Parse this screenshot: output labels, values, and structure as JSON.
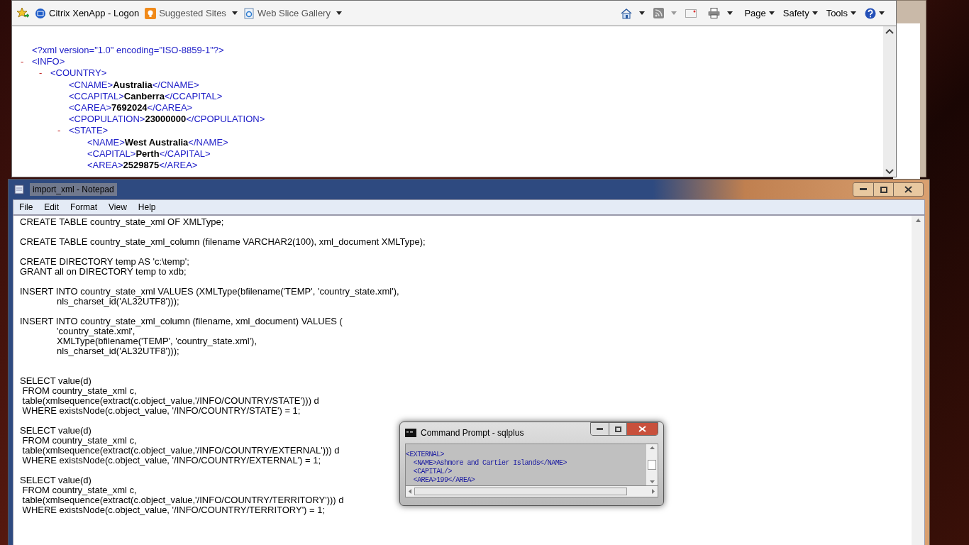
{
  "browser": {
    "favorites_bar": [
      {
        "label": "Citrix XenApp - Logon",
        "dropdown": false
      },
      {
        "label": "Suggested Sites",
        "dropdown": true
      },
      {
        "label": "Web Slice Gallery",
        "dropdown": true
      }
    ],
    "command_bar": [
      "Page",
      "Safety",
      "Tools"
    ],
    "xml": [
      {
        "kind": "pi",
        "text": "<?xml version=\"1.0\" encoding=\"ISO-8859-1\"?>"
      },
      {
        "kind": "parent",
        "toggle": "-",
        "tag": "<INFO>",
        "children": [
          {
            "kind": "parent",
            "toggle": "-",
            "tag": "<COUNTRY>",
            "children": [
              {
                "kind": "leaf",
                "open": "<CNAME>",
                "value": "Australia",
                "close": "</CNAME>"
              },
              {
                "kind": "leaf",
                "open": "<CCAPITAL>",
                "value": "Canberra",
                "close": "</CCAPITAL>"
              },
              {
                "kind": "leaf",
                "open": "<CAREA>",
                "value": "7692024",
                "close": "</CAREA>"
              },
              {
                "kind": "leaf",
                "open": "<CPOPULATION>",
                "value": "23000000",
                "close": "</CPOPULATION>"
              },
              {
                "kind": "parent",
                "toggle": "-",
                "tag": "<STATE>",
                "children": [
                  {
                    "kind": "leaf",
                    "open": "<NAME>",
                    "value": "West Australia",
                    "close": "</NAME>"
                  },
                  {
                    "kind": "leaf",
                    "open": "<CAPITAL>",
                    "value": "Perth",
                    "close": "</CAPITAL>"
                  },
                  {
                    "kind": "leaf",
                    "open": "<AREA>",
                    "value": "2529875",
                    "close": "</AREA>"
                  }
                ]
              }
            ]
          }
        ]
      }
    ]
  },
  "notepad": {
    "title": "import_xml - Notepad",
    "menu": [
      "File",
      "Edit",
      "Format",
      "View",
      "Help"
    ],
    "paragraphs": [
      [
        "CREATE TABLE country_state_xml OF XMLType;"
      ],
      [
        "CREATE TABLE country_state_xml_column (filename VARCHAR2(100), xml_document XMLType);"
      ],
      [
        "CREATE DIRECTORY temp AS 'c:\\temp';",
        "GRANT all on DIRECTORY temp to xdb;"
      ],
      [
        "INSERT INTO country_state_xml VALUES (XMLType(bfilename('TEMP', 'country_state.xml'),",
        "\tnls_charset_id('AL32UTF8')));"
      ],
      [
        "INSERT INTO country_state_xml_column (filename, xml_document) VALUES (",
        "\t'country_state.xml',",
        "\tXMLType(bfilename('TEMP', 'country_state.xml'),",
        "\tnls_charset_id('AL32UTF8')));"
      ],
      [
        "SELECT value(d)",
        " FROM country_state_xml c,",
        " table(xmlsequence(extract(c.object_value,'/INFO/COUNTRY/STATE'))) d",
        " WHERE existsNode(c.object_value, '/INFO/COUNTRY/STATE') = 1;"
      ],
      [
        "SELECT value(d)",
        " FROM country_state_xml c,",
        " table(xmlsequence(extract(c.object_value,'/INFO/COUNTRY/EXTERNAL'))) d",
        " WHERE existsNode(c.object_value, '/INFO/COUNTRY/EXTERNAL') = 1;"
      ],
      [
        "SELECT value(d)",
        " FROM country_state_xml c,",
        " table(xmlsequence(extract(c.object_value,'/INFO/COUNTRY/TERRITORY'))) d",
        " WHERE existsNode(c.object_value, '/INFO/COUNTRY/TERRITORY') = 1;"
      ]
    ]
  },
  "console": {
    "title": "Command Prompt - sqlplus",
    "lines": [
      "<EXTERNAL>",
      "  <NAME>Ashmore and Cartier Islands</NAME>",
      "  <CAPITAL/>",
      "  <AREA>199</AREA>"
    ]
  }
}
